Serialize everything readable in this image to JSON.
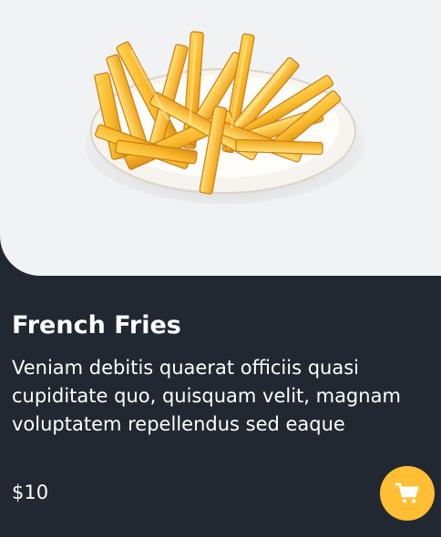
{
  "product": {
    "image_icon": "french-fries-plate-image",
    "title": "French Fries",
    "description": "Veniam debitis quaerat officiis quasi cupiditate quo, quisquam velit, magnam voluptatem repellendus sed eaque",
    "price": "$10",
    "cart_icon": "shopping-cart-icon"
  },
  "colors": {
    "card_background": "#222831",
    "image_background": "#f1f2f3",
    "accent": "#ffbe33",
    "text": "#ffffff"
  }
}
